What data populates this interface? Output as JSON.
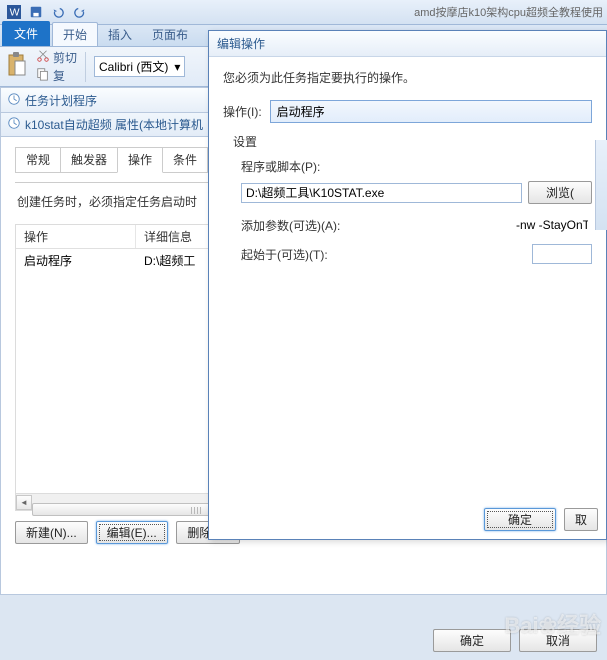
{
  "app_title": "amd按摩店k10架构cpu超频全教程使用",
  "ribbon": {
    "file": "文件",
    "tabs": [
      "开始",
      "插入",
      "页面布"
    ],
    "clipboard": {
      "cut": "剪切",
      "copy": "复"
    },
    "font_select": "Calibri (西文)"
  },
  "task_scheduler": {
    "title": "任务计划程序"
  },
  "properties": {
    "title": "k10stat自动超频 属性(本地计算机",
    "tabs": [
      "常规",
      "触发器",
      "操作",
      "条件"
    ],
    "active_tab": 2,
    "desc": "创建任务时，必须指定任务启动时",
    "columns": [
      "操作",
      "详细信息"
    ],
    "rows": [
      {
        "action": "启动程序",
        "detail": "D:\\超频工"
      }
    ],
    "buttons": {
      "new": "新建(N)...",
      "edit": "编辑(E)...",
      "delete": "删除(D)"
    }
  },
  "dialog": {
    "title": "编辑操作",
    "message": "您必须为此任务指定要执行的操作。",
    "op_label": "操作(I):",
    "op_value": "启动程序",
    "settings_label": "设置",
    "program_label": "程序或脚本(P):",
    "program_value": "D:\\超频工具\\K10STAT.exe",
    "browse": "浏览(",
    "args_label": "添加参数(可选)(A):",
    "args_value": "-nw -StayOnTray",
    "startin_label": "起始于(可选)(T):",
    "startin_value": "",
    "ok": "确定",
    "cancel": "取"
  },
  "footer": {
    "ok": "确定",
    "cancel": "取消"
  },
  "watermark": "Bai❀经验"
}
